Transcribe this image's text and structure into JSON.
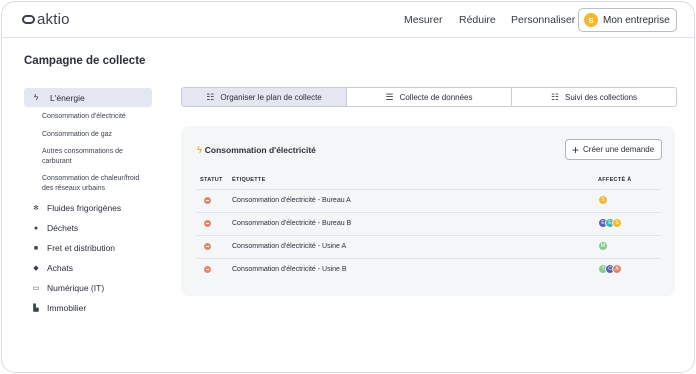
{
  "header": {
    "logo_text": "aktio",
    "nav": [
      "Mesurer",
      "Réduire",
      "Personnaliser"
    ],
    "company": {
      "avatar_initial": "S",
      "label": "Mon entreprise"
    }
  },
  "page_title": "Campagne de collecte",
  "sidebar": {
    "active": {
      "label": "L'énergie",
      "icon": "bolt-icon"
    },
    "sub_items": [
      "Consommation d'électricité",
      "Consommation de gaz",
      "Autres consommations de carburant",
      "Consommation de chaleur/froid des réseaux urbains"
    ],
    "categories": [
      {
        "label": "Fluides frigorigènes",
        "icon": "snowflake-icon"
      },
      {
        "label": "Déchets",
        "icon": "drop-icon"
      },
      {
        "label": "Fret et distribution",
        "icon": "truck-icon"
      },
      {
        "label": "Achats",
        "icon": "cart-icon"
      },
      {
        "label": "Numérique (IT)",
        "icon": "monitor-icon"
      },
      {
        "label": "Immobilier",
        "icon": "building-icon"
      }
    ]
  },
  "tabs": [
    {
      "label": "Organiser le plan de collecte",
      "icon": "plan-icon",
      "active": true
    },
    {
      "label": "Collecte de données",
      "icon": "list-icon",
      "active": false
    },
    {
      "label": "Suivi des collections",
      "icon": "checklist-icon",
      "active": false
    }
  ],
  "card": {
    "title": "Consommation d'électricité",
    "create_button": "Créer une demande",
    "columns": {
      "status": "STATUT",
      "label": "ÉTIQUETTE",
      "assigned": "AFFECTÉ À"
    },
    "rows": [
      {
        "label": "Consommation d'électricité - Bureau A",
        "assignees": [
          {
            "initial": "S",
            "color": "#f5b82e"
          }
        ]
      },
      {
        "label": "Consommation d'électricité - Bureau B",
        "assignees": [
          {
            "initial": "E",
            "color": "#5b5fb8"
          },
          {
            "initial": "E",
            "color": "#3fb7a6"
          },
          {
            "initial": "S",
            "color": "#f5b82e"
          }
        ]
      },
      {
        "label": "Consommation d'électricité - Usine A",
        "assignees": [
          {
            "initial": "M",
            "color": "#7fcf8d"
          }
        ]
      },
      {
        "label": "Consommation d'électricité - Usine B",
        "assignees": [
          {
            "initial": "T",
            "color": "#7fcf8d"
          },
          {
            "initial": "C",
            "color": "#5b5fb8"
          },
          {
            "initial": "A",
            "color": "#e3876a"
          }
        ]
      }
    ]
  },
  "colors": {
    "accent_bg": "#e4e6f1",
    "status_red": "#e3876a",
    "bolt": "#f0a62b"
  }
}
